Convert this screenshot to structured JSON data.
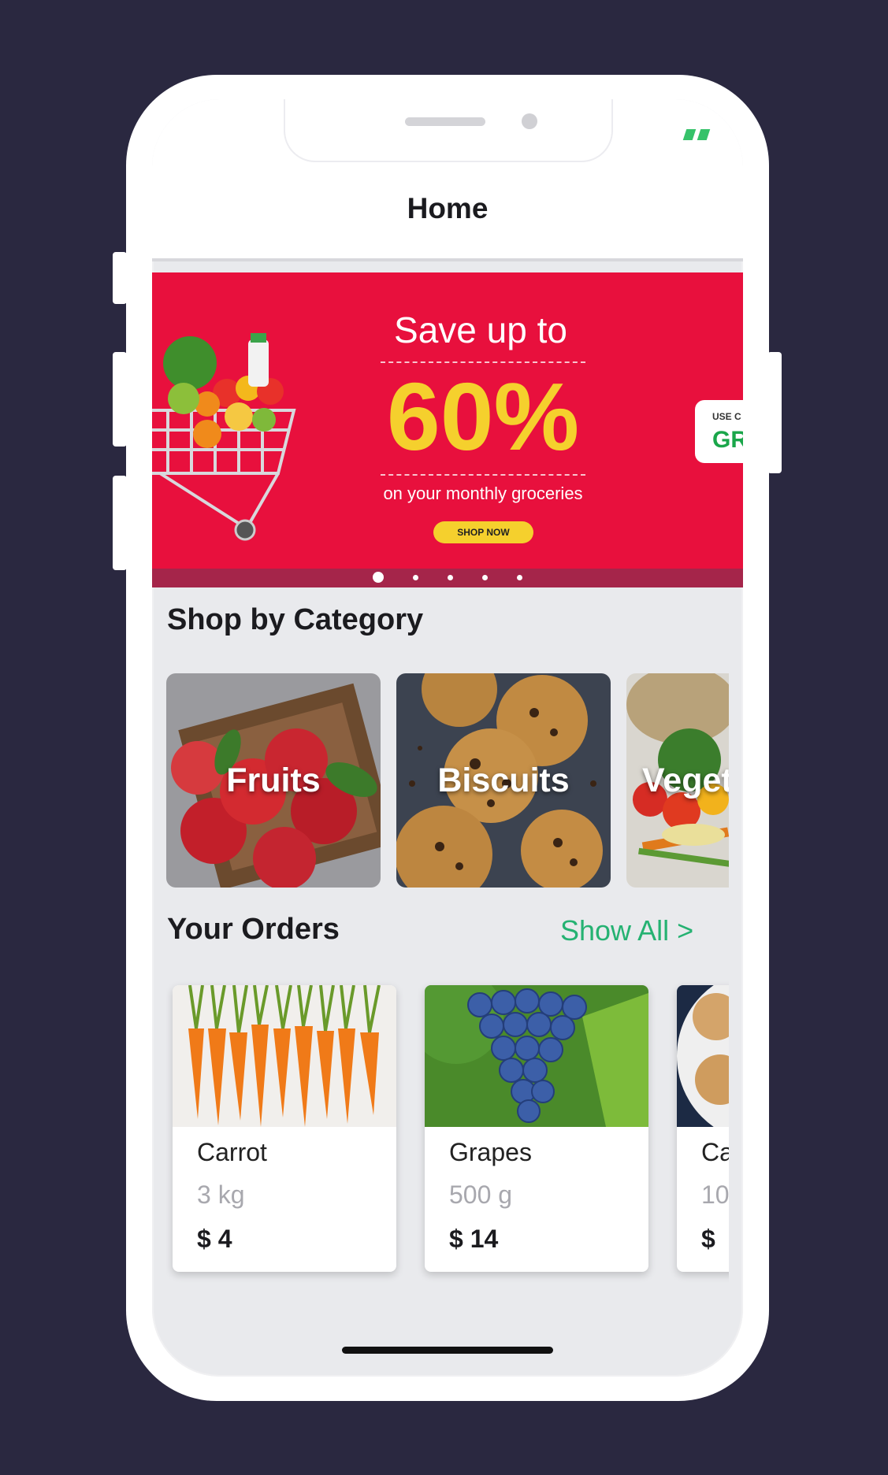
{
  "app": {
    "title": "Home"
  },
  "banner": {
    "headline": "Save up to",
    "percent": "60%",
    "subtext": "on your monthly groceries",
    "cta": "SHOP NOW",
    "coupon_label": "USE C",
    "coupon_code": "GR",
    "slides": 5,
    "active_slide": 1,
    "colors": {
      "background": "#e8103d",
      "accent": "#f5d02d"
    }
  },
  "categories": {
    "title": "Shop by Category",
    "items": [
      {
        "label": "Fruits"
      },
      {
        "label": "Biscuits"
      },
      {
        "label": "Veget"
      }
    ]
  },
  "orders": {
    "title": "Your Orders",
    "show_all": "Show All >",
    "items": [
      {
        "name": "Carrot",
        "quantity": "3 kg",
        "price": "$ 4"
      },
      {
        "name": "Grapes",
        "quantity": "500 g",
        "price": "$ 14"
      },
      {
        "name": "Ca",
        "quantity": "10",
        "price": "$"
      }
    ]
  },
  "theme": {
    "accent_green": "#25b272",
    "screen_bg": "#e9eaed"
  }
}
